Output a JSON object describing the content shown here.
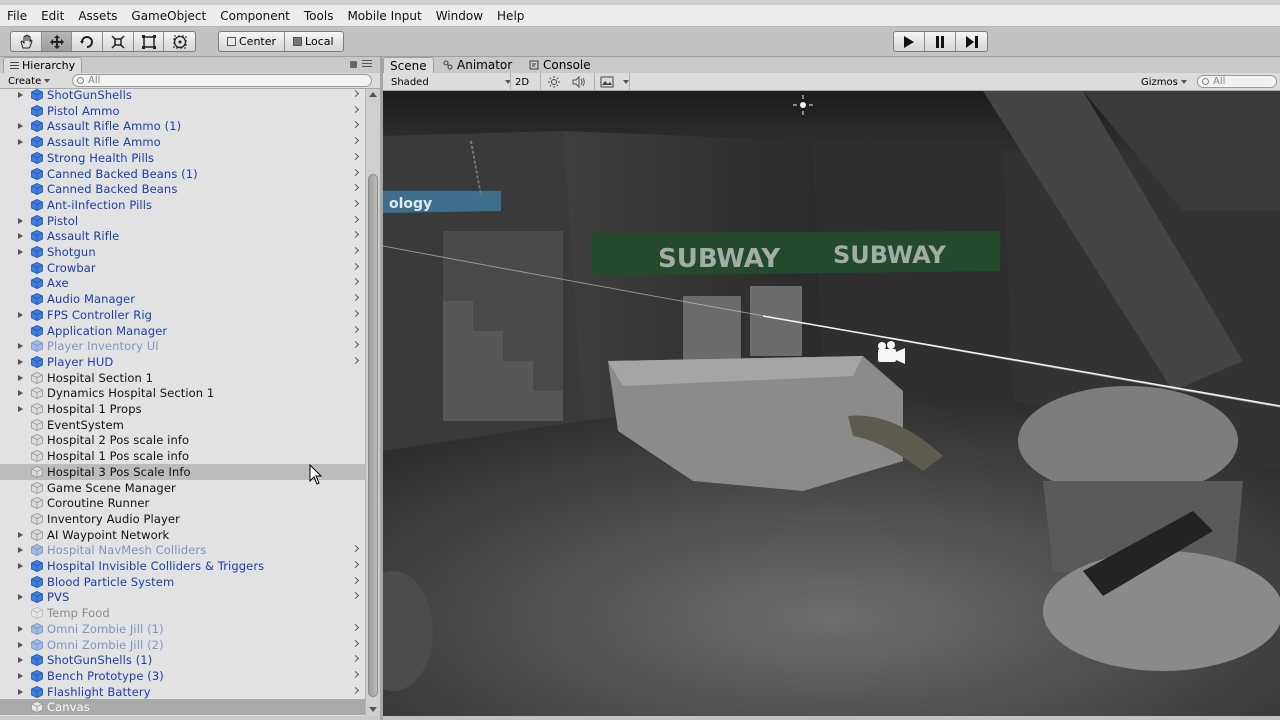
{
  "menu": [
    "File",
    "Edit",
    "Assets",
    "GameObject",
    "Component",
    "Tools",
    "Mobile Input",
    "Window",
    "Help"
  ],
  "toolbar": {
    "tools": [
      "hand-tool",
      "move-tool",
      "rotate-tool",
      "scale-tool",
      "rect-tool",
      "transform-tool"
    ],
    "active_tool": "move-tool",
    "pivot_mode": "Center",
    "pivot_rotation": "Local"
  },
  "hierarchy": {
    "tab_label": "Hierarchy",
    "create_label": "Create",
    "search_placeholder": "All",
    "rows": [
      {
        "label": "ShotGunShells",
        "kind": "prefab",
        "arrow": true,
        "chevron": true,
        "selected": false
      },
      {
        "label": "Pistol Ammo",
        "kind": "prefab",
        "arrow": false,
        "chevron": true,
        "selected": false
      },
      {
        "label": "Assault Rifle Ammo (1)",
        "kind": "prefab",
        "arrow": true,
        "chevron": true,
        "selected": false
      },
      {
        "label": "Assault Rifle Ammo",
        "kind": "prefab",
        "arrow": true,
        "chevron": true,
        "selected": false
      },
      {
        "label": "Strong Health Pills",
        "kind": "prefab",
        "arrow": false,
        "chevron": true,
        "selected": false
      },
      {
        "label": "Canned Backed Beans (1)",
        "kind": "prefab",
        "arrow": false,
        "chevron": true,
        "selected": false
      },
      {
        "label": "Canned Backed Beans",
        "kind": "prefab",
        "arrow": false,
        "chevron": true,
        "selected": false
      },
      {
        "label": "Ant-iInfection Pills",
        "kind": "prefab",
        "arrow": false,
        "chevron": true,
        "selected": false
      },
      {
        "label": "Pistol",
        "kind": "prefab",
        "arrow": true,
        "chevron": true,
        "selected": false
      },
      {
        "label": "Assault Rifle",
        "kind": "prefab",
        "arrow": true,
        "chevron": true,
        "selected": false
      },
      {
        "label": "Shotgun",
        "kind": "prefab",
        "arrow": true,
        "chevron": true,
        "selected": false
      },
      {
        "label": "Crowbar",
        "kind": "prefab",
        "arrow": false,
        "chevron": true,
        "selected": false
      },
      {
        "label": "Axe",
        "kind": "prefab",
        "arrow": false,
        "chevron": true,
        "selected": false
      },
      {
        "label": "Audio Manager",
        "kind": "prefab",
        "arrow": false,
        "chevron": true,
        "selected": false
      },
      {
        "label": "FPS Controller Rig",
        "kind": "prefab",
        "arrow": true,
        "chevron": true,
        "selected": false
      },
      {
        "label": "Application Manager",
        "kind": "prefab",
        "arrow": false,
        "chevron": true,
        "selected": false
      },
      {
        "label": "Player Inventory UI",
        "kind": "disabled-prefab",
        "arrow": true,
        "chevron": true,
        "selected": false
      },
      {
        "label": "Player HUD",
        "kind": "prefab",
        "arrow": true,
        "chevron": true,
        "selected": false
      },
      {
        "label": "Hospital Section 1",
        "kind": "normal",
        "arrow": true,
        "chevron": false,
        "selected": false
      },
      {
        "label": "Dynamics Hospital Section 1",
        "kind": "normal",
        "arrow": true,
        "chevron": false,
        "selected": false
      },
      {
        "label": "Hospital 1 Props",
        "kind": "normal",
        "arrow": true,
        "chevron": false,
        "selected": false
      },
      {
        "label": "EventSystem",
        "kind": "normal",
        "arrow": false,
        "chevron": false,
        "selected": false
      },
      {
        "label": "Hospital 2 Pos scale info",
        "kind": "normal",
        "arrow": false,
        "chevron": false,
        "selected": false
      },
      {
        "label": "Hospital 1 Pos scale info",
        "kind": "normal",
        "arrow": false,
        "chevron": false,
        "selected": false
      },
      {
        "label": "Hospital 3 Pos Scale Info",
        "kind": "normal",
        "arrow": false,
        "chevron": false,
        "selected": true
      },
      {
        "label": "Game Scene Manager",
        "kind": "normal",
        "arrow": false,
        "chevron": false,
        "selected": false
      },
      {
        "label": "Coroutine Runner",
        "kind": "normal",
        "arrow": false,
        "chevron": false,
        "selected": false
      },
      {
        "label": "Inventory Audio Player",
        "kind": "normal",
        "arrow": false,
        "chevron": false,
        "selected": false
      },
      {
        "label": "AI Waypoint Network",
        "kind": "normal",
        "arrow": true,
        "chevron": false,
        "selected": false
      },
      {
        "label": "Hospital NavMesh Colliders",
        "kind": "disabled-prefab",
        "arrow": true,
        "chevron": true,
        "selected": false
      },
      {
        "label": "Hospital Invisible Colliders & Triggers",
        "kind": "prefab",
        "arrow": true,
        "chevron": true,
        "selected": false
      },
      {
        "label": "Blood Particle System",
        "kind": "prefab",
        "arrow": false,
        "chevron": true,
        "selected": false
      },
      {
        "label": "PVS",
        "kind": "prefab",
        "arrow": true,
        "chevron": true,
        "selected": false
      },
      {
        "label": "Temp Food",
        "kind": "disabled",
        "arrow": false,
        "chevron": false,
        "selected": false
      },
      {
        "label": "Omni Zombie Jill (1)",
        "kind": "disabled-prefab",
        "arrow": true,
        "chevron": true,
        "selected": false
      },
      {
        "label": "Omni Zombie Jill (2)",
        "kind": "disabled-prefab",
        "arrow": true,
        "chevron": true,
        "selected": false
      },
      {
        "label": "ShotGunShells (1)",
        "kind": "prefab",
        "arrow": true,
        "chevron": true,
        "selected": false
      },
      {
        "label": "Bench Prototype (3)",
        "kind": "prefab",
        "arrow": true,
        "chevron": true,
        "selected": false
      },
      {
        "label": "Flashlight Battery",
        "kind": "prefab",
        "arrow": true,
        "chevron": true,
        "selected": false
      },
      {
        "label": "Canvas",
        "kind": "canvas",
        "arrow": false,
        "chevron": false,
        "selected": false
      }
    ]
  },
  "scene": {
    "tabs": [
      {
        "label": "Scene",
        "icon": "scene-icon",
        "active": true
      },
      {
        "label": "Animator",
        "icon": "animator-icon",
        "active": false
      },
      {
        "label": "Console",
        "icon": "console-icon",
        "active": false
      }
    ],
    "shading_mode": "Shaded",
    "mode_2d": "2D",
    "gizmos_label": "Gizmos",
    "search_placeholder": "All",
    "sign_text": "ology",
    "sign_text_2": "SUBWAY",
    "sign_text_3": "SUBWAY"
  },
  "colors": {
    "prefab_text": "#1a3fa8",
    "prefab_cube": "#2f73d6",
    "selected_row": "#bcbcbc",
    "viewport_bg": "#2d2d2d"
  }
}
